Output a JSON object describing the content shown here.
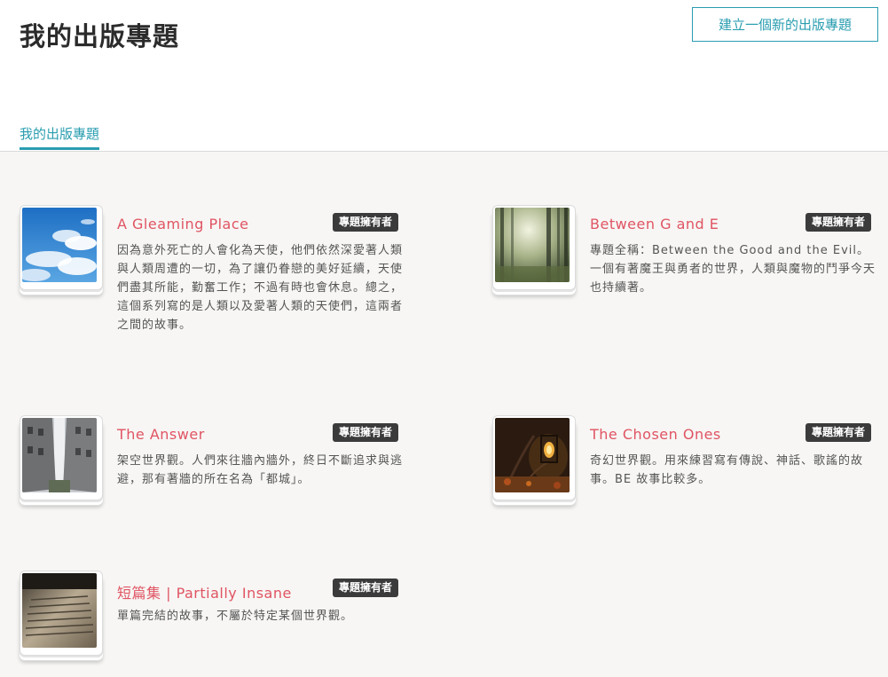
{
  "header": {
    "title": "我的出版專題",
    "create_button": "建立一個新的出版專題"
  },
  "tabs": [
    {
      "label": "我的出版專題",
      "active": true
    }
  ],
  "colors": {
    "accent": "#2a9db0",
    "title_red": "#e05463",
    "badge_bg": "#3b3b3b",
    "background": "#f7f6f4"
  },
  "projects": [
    {
      "title": "A Gleaming Place",
      "badge": "專題擁有者",
      "description": "因為意外死亡的人會化為天使，他們依然深愛著人類與人類周遭的一切，為了讓仍眷戀的美好延續，天使們盡其所能，勤奮工作；不過有時也會休息。總之，這個系列寫的是人類以及愛著人類的天使們，這兩者之間的故事。",
      "thumbnail": "blue-sky-clouds-image"
    },
    {
      "title": "Between G and E",
      "badge": "專題擁有者",
      "description": "專題全稱：Between the Good and the Evil。一個有著魔王與勇者的世界，人類與魔物的鬥爭今天也持續著。",
      "thumbnail": "misty-forest-image"
    },
    {
      "title": "The Answer",
      "badge": "專題擁有者",
      "description": "架空世界觀。人們來往牆內牆外，終日不斷追求與逃避，那有著牆的所在名為「都城」。",
      "thumbnail": "city-street-image"
    },
    {
      "title": "The Chosen Ones",
      "badge": "專題擁有者",
      "description": "奇幻世界觀。用來練習寫有傳說、神話、歌謠的故事。BE 故事比較多。",
      "thumbnail": "lantern-autumn-image"
    },
    {
      "title": "短篇集 | Partially Insane",
      "badge": "專題擁有者",
      "description": "單篇完結的故事，不屬於特定某個世界觀。",
      "thumbnail": "book-pages-image"
    }
  ]
}
